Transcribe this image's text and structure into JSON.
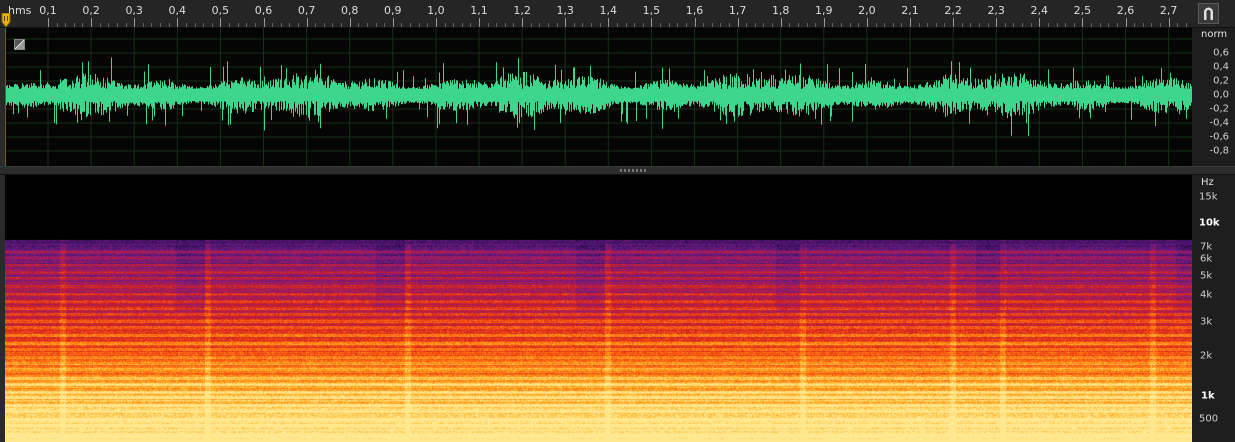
{
  "ruler": {
    "unit_label": "hms",
    "time_labels": [
      "0,1",
      "0,2",
      "0,3",
      "0,4",
      "0,5",
      "0,6",
      "0,7",
      "0,8",
      "0,9",
      "1,0",
      "1,1",
      "1,2",
      "1,3",
      "1,4",
      "1,5",
      "1,6",
      "1,7",
      "1,8",
      "1,9",
      "2,0",
      "2,1",
      "2,2",
      "2,3",
      "2,4",
      "2,5",
      "2,6",
      "2,7"
    ],
    "snap_icon": "magnet-icon"
  },
  "waveform": {
    "scale_unit": "norm",
    "scale_labels": [
      "0,6",
      "0,4",
      "0,2",
      "0,0",
      "-0,2",
      "-0,4",
      "-0,6",
      "-0,8"
    ],
    "color": "#3dd68c",
    "toggle_icon": "waveform-display-toggle-icon"
  },
  "spectrogram": {
    "scale_unit": "Hz",
    "freq_labels": [
      {
        "text": "15k",
        "strong": false
      },
      {
        "text": "10k",
        "strong": true
      },
      {
        "text": "7k",
        "strong": false
      },
      {
        "text": "6k",
        "strong": false
      },
      {
        "text": "5k",
        "strong": false
      },
      {
        "text": "4k",
        "strong": false
      },
      {
        "text": "3k",
        "strong": false
      },
      {
        "text": "2k",
        "strong": false
      },
      {
        "text": "1k",
        "strong": true
      },
      {
        "text": "500",
        "strong": false
      }
    ],
    "palette": [
      "#000000",
      "#2a0a4a",
      "#5a1a80",
      "#9a1a6a",
      "#d02020",
      "#ff5a10",
      "#ffb020",
      "#ffe890"
    ]
  }
}
